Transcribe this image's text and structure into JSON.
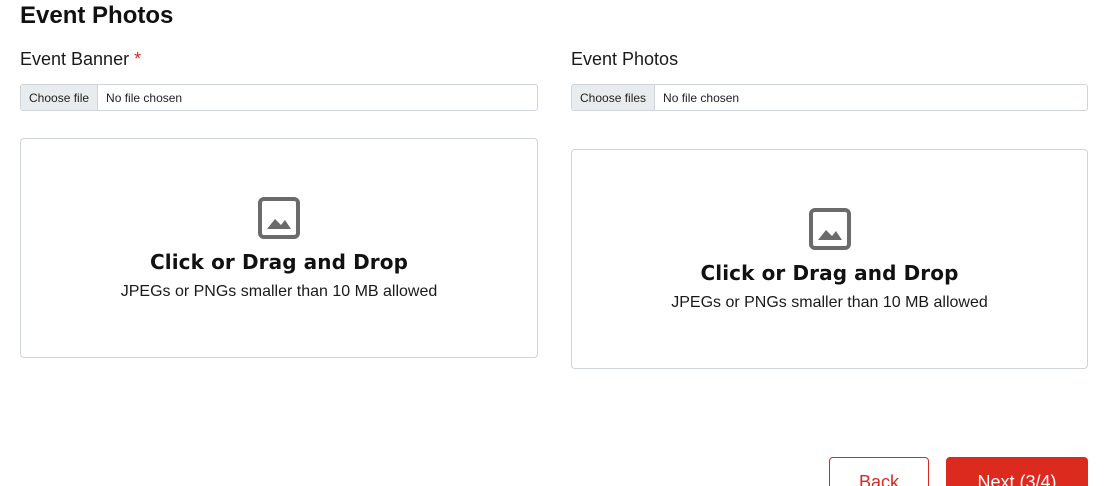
{
  "section": {
    "title": "Event Photos"
  },
  "banner": {
    "label": "Event Banner",
    "required_mark": "*",
    "file_button": "Choose file",
    "file_status": "No file chosen",
    "dropzone": {
      "icon": "image-icon",
      "title": "Click or Drag and Drop",
      "subtitle": "JPEGs or PNGs smaller than 10 MB allowed"
    }
  },
  "photos": {
    "label": "Event Photos",
    "file_button": "Choose files",
    "file_status": "No file chosen",
    "dropzone": {
      "icon": "image-icon",
      "title": "Click or Drag and Drop",
      "subtitle": "JPEGs or PNGs smaller than 10 MB allowed"
    }
  },
  "actions": {
    "back_label": "Back",
    "next_label": "Next (3/4)"
  },
  "colors": {
    "accent": "#dc2a1f",
    "border": "#cfd4da",
    "icon": "#6b6b6b"
  }
}
